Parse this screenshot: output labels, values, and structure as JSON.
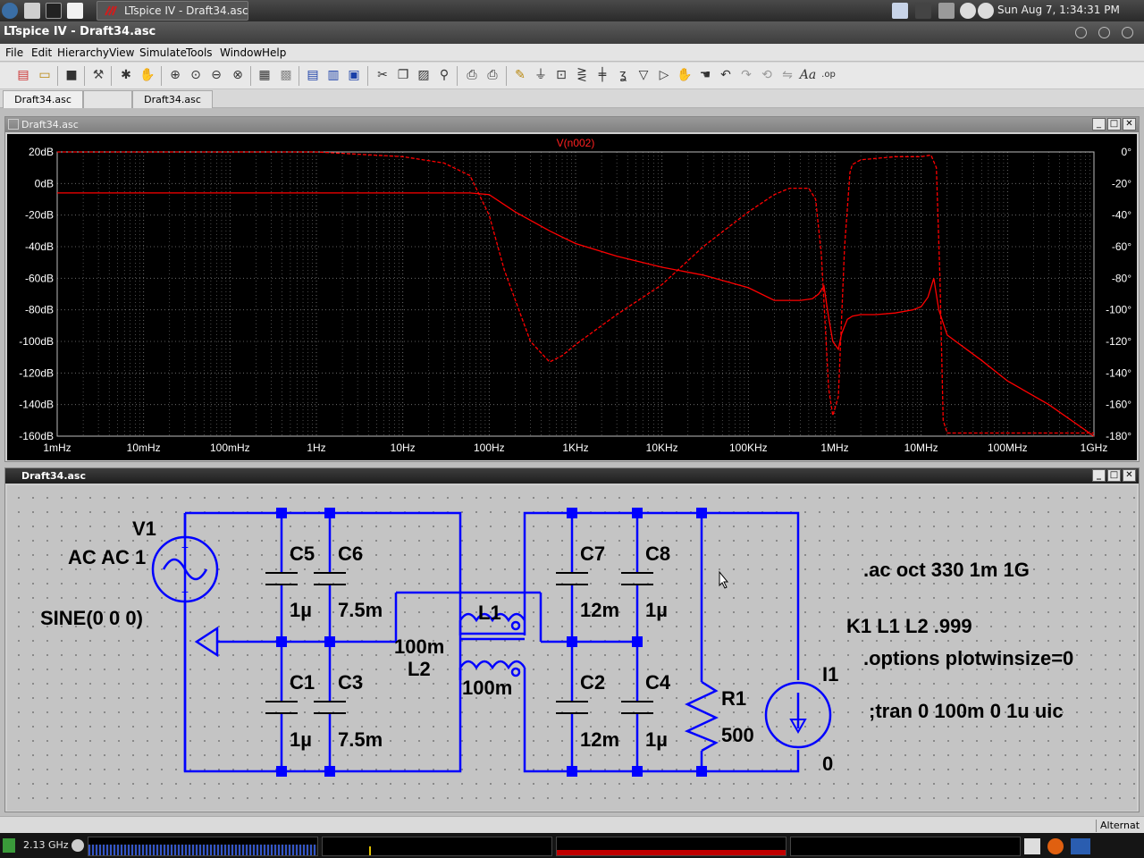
{
  "system_bar": {
    "task_title": "LTspice IV - Draft34.asc",
    "clock": "Sun Aug  7,  1:34:31 PM"
  },
  "window": {
    "title": "LTspice IV - Draft34.asc"
  },
  "menu": {
    "items": [
      "File",
      "Edit",
      "Hierarchy",
      "View",
      "Simulate",
      "Tools",
      "Window",
      "Help"
    ]
  },
  "toolbar": {
    "label_text_icon": "Aa",
    "label_op_icon": ".op"
  },
  "doc_tabs": [
    "Draft34.asc",
    "",
    "Draft34.asc"
  ],
  "plot_window": {
    "title": "Draft34.asc",
    "trace_label": "V(n002)"
  },
  "chart_data": {
    "type": "line",
    "title": "",
    "x_scale": "log",
    "xlim": [
      0.001,
      1000000000
    ],
    "ylim_left_db": [
      -160,
      20
    ],
    "ylim_right_deg": [
      -180,
      0
    ],
    "x_tick_labels": [
      "1mHz",
      "10mHz",
      "100mHz",
      "1Hz",
      "10Hz",
      "100Hz",
      "1KHz",
      "10KHz",
      "100KHz",
      "1MHz",
      "10MHz",
      "100MHz",
      "1GHz"
    ],
    "y_left_tick_labels": [
      "20dB",
      "0dB",
      "-20dB",
      "-40dB",
      "-60dB",
      "-80dB",
      "-100dB",
      "-120dB",
      "-140dB",
      "-160dB"
    ],
    "y_right_tick_labels": [
      "0°",
      "-20°",
      "-40°",
      "-60°",
      "-80°",
      "-100°",
      "-120°",
      "-140°",
      "-160°",
      "-180°"
    ],
    "grid": true,
    "series": [
      {
        "name": "V(n002)",
        "axis": "left",
        "style": "solid",
        "x": [
          0.001,
          0.01,
          0.1,
          1,
          3,
          10,
          30,
          60,
          100,
          200,
          500,
          1000,
          3000,
          10000,
          30000,
          100000,
          200000,
          400000,
          550000,
          650000,
          750000,
          850000,
          950000,
          1100000,
          1200000,
          1400000,
          1600000,
          2000000,
          3000000,
          5000000,
          8000000,
          10000000,
          12000000,
          14000000,
          16000000,
          20000000,
          50000000,
          100000000,
          300000000,
          1000000000
        ],
        "y": [
          -6,
          -6,
          -6,
          -6,
          -6,
          -6,
          -6,
          -6,
          -7,
          -18,
          -30,
          -38,
          -46,
          -53,
          -58,
          -66,
          -74,
          -74,
          -73,
          -70,
          -65,
          -85,
          -100,
          -105,
          -95,
          -86,
          -84,
          -83,
          -83,
          -82,
          -80,
          -78,
          -72,
          -60,
          -80,
          -96,
          -112,
          -125,
          -140,
          -160
        ]
      },
      {
        "name": "V(n002) phase",
        "axis": "right",
        "style": "dashed",
        "x": [
          0.001,
          0.01,
          0.1,
          1,
          10,
          30,
          60,
          100,
          150,
          300,
          500,
          700,
          1000,
          3000,
          10000,
          30000,
          100000,
          200000,
          300000,
          500000,
          600000,
          700000,
          850000,
          950000,
          1100000,
          1300000,
          1500000,
          1600000,
          2000000,
          5000000,
          10000000,
          13000000,
          15000000,
          16500000,
          18000000,
          20000000,
          100000000,
          1000000000
        ],
        "y_deg": [
          0,
          0,
          0,
          0,
          -3,
          -7,
          -15,
          -40,
          -75,
          -120,
          -133,
          -129,
          -122,
          -103,
          -84,
          -60,
          -38,
          -27,
          -23,
          -23,
          -30,
          -65,
          -150,
          -167,
          -155,
          -60,
          -13,
          -8,
          -5,
          -3,
          -3,
          -2,
          -10,
          -80,
          -170,
          -178,
          -178,
          -178
        ]
      }
    ]
  },
  "schematic_window": {
    "title": "Draft34.asc",
    "labels": {
      "v1_name": "V1",
      "v1_ac": "AC AC 1",
      "v1_sine": "SINE(0 0 0)",
      "c5": "C5",
      "c5_val": "1µ",
      "c6": "C6",
      "c6_val": "7.5m",
      "c1": "C1",
      "c1_val": "1µ",
      "c3": "C3",
      "c3_val": "7.5m",
      "l1": "L1",
      "l1_val": "100m",
      "l2": "L2",
      "l2_val": "100m",
      "c7": "C7",
      "c7_val": "12m",
      "c8": "C8",
      "c8_val": "1µ",
      "c2": "C2",
      "c2_val": "12m",
      "c4": "C4",
      "c4_val": "1µ",
      "r1": "R1",
      "r1_val": "500",
      "i1": "I1",
      "i1_val": "0"
    },
    "directives": {
      "ac": ".ac oct 330 1m 1G",
      "k1": "K1 L1 L2 .999",
      "options": ".options plotwinsize=0",
      "tran": ";tran 0 100m 0 1u uic"
    },
    "colors": {
      "wire": "#0000ff",
      "component": "#000000",
      "junction": "#0000ff"
    }
  },
  "status_bar": {
    "text": "Alternat"
  },
  "panel": {
    "cpu_freq": "2.13 GHz"
  },
  "colors": {
    "trace": "#ff0000",
    "plot_bg": "#000000",
    "grid": "#a0a0a0",
    "axis_text": "#ffffff"
  }
}
